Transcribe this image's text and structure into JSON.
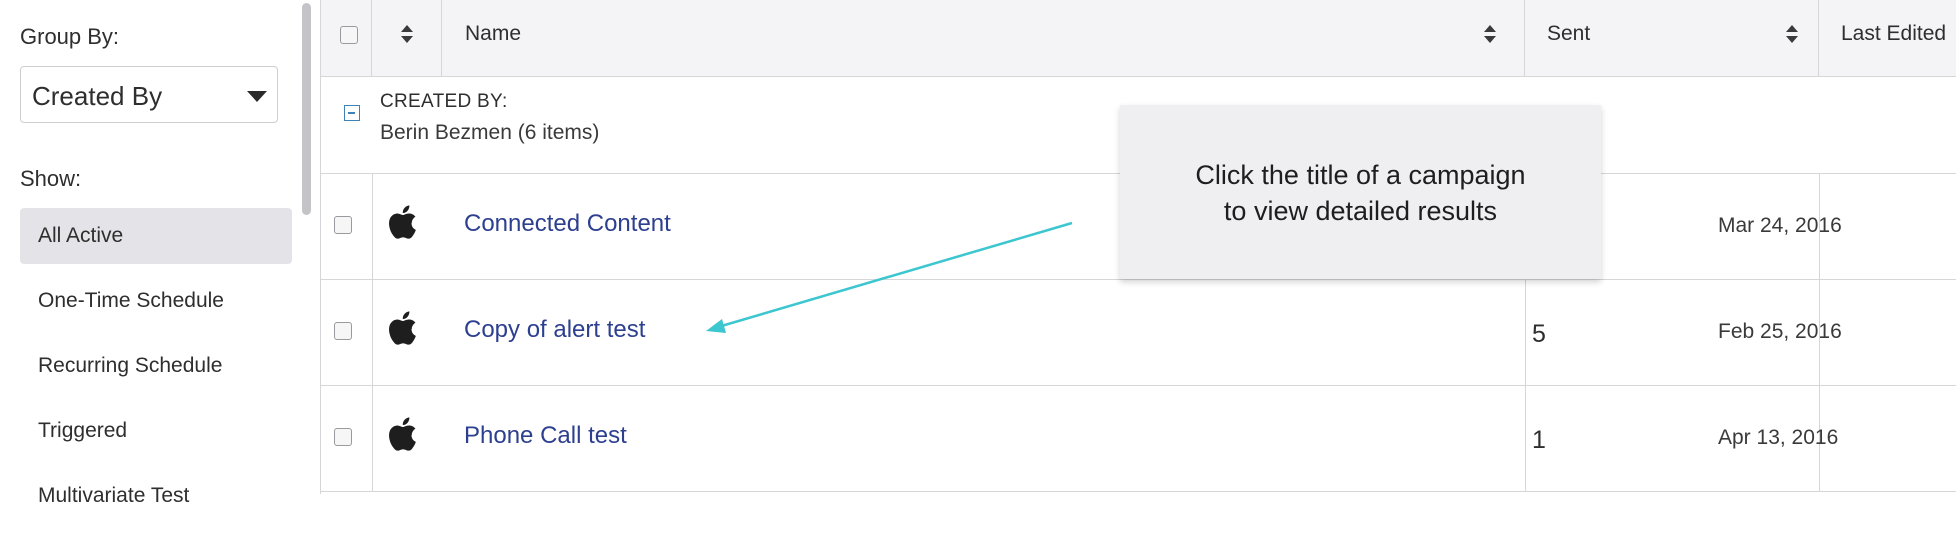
{
  "sidebar": {
    "group_by_label": "Group By:",
    "group_by_value": "Created By",
    "show_label": "Show:",
    "filters": [
      {
        "label": "All Active",
        "active": true
      },
      {
        "label": "One-Time Schedule",
        "active": false
      },
      {
        "label": "Recurring Schedule",
        "active": false
      },
      {
        "label": "Triggered",
        "active": false
      },
      {
        "label": "Multivariate Test",
        "active": false
      }
    ]
  },
  "table": {
    "headers": {
      "name": "Name",
      "sent": "Sent",
      "last_edited": "Last Edited"
    },
    "group": {
      "title": "CREATED BY:",
      "subtitle": "Berin Bezmen (6 items)"
    },
    "rows": [
      {
        "name": "Connected Content",
        "sent": "",
        "last_edited": "Mar 24, 2016",
        "platform_icon": "apple-icon"
      },
      {
        "name": "Copy of alert test",
        "sent": "5",
        "last_edited": "Feb 25, 2016",
        "platform_icon": "apple-icon"
      },
      {
        "name": "Phone Call test",
        "sent": "1",
        "last_edited": "Apr 13, 2016",
        "platform_icon": "apple-icon"
      }
    ]
  },
  "callout": {
    "text": "Click the title of a campaign\nto view detailed results"
  },
  "colors": {
    "link": "#2d3f8f",
    "arrow": "#3cc6cf",
    "active_filter_bg": "#e4e4e8"
  }
}
